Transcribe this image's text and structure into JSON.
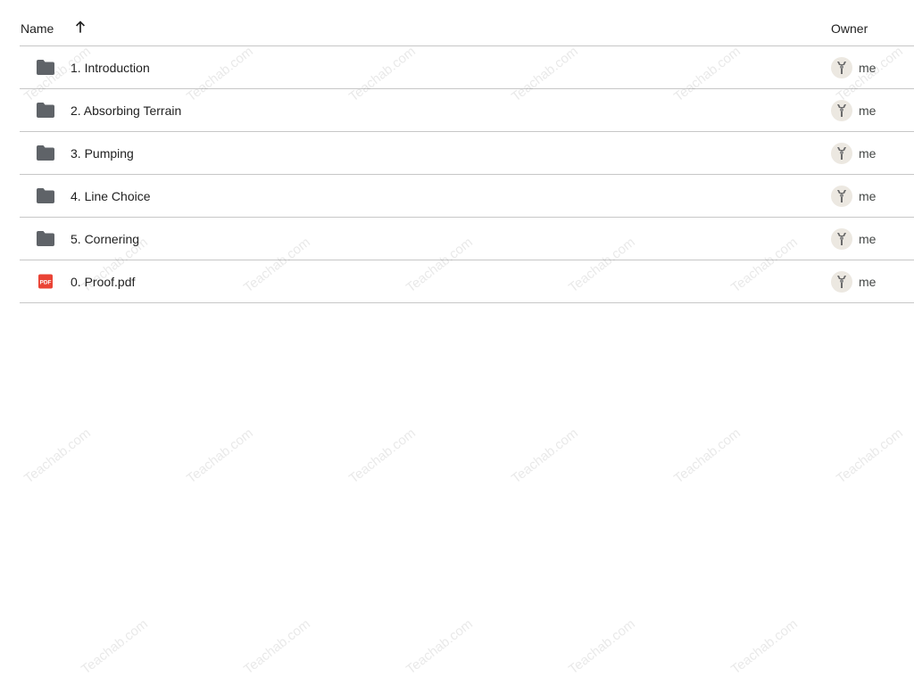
{
  "header": {
    "name_label": "Name",
    "owner_label": "Owner",
    "sort_icon": "arrow-upward-icon"
  },
  "items": [
    {
      "name": "1. Introduction",
      "type": "folder",
      "icon": "folder-icon",
      "owner": "me"
    },
    {
      "name": "2. Absorbing Terrain",
      "type": "folder",
      "icon": "folder-icon",
      "owner": "me"
    },
    {
      "name": "3. Pumping",
      "type": "folder",
      "icon": "folder-icon",
      "owner": "me"
    },
    {
      "name": "4. Line Choice",
      "type": "folder",
      "icon": "folder-icon",
      "owner": "me"
    },
    {
      "name": "5. Cornering",
      "type": "folder",
      "icon": "folder-icon",
      "owner": "me"
    },
    {
      "name": "0. Proof.pdf",
      "type": "pdf",
      "icon": "pdf-file-icon",
      "icon_text": "PDF",
      "owner": "me"
    }
  ],
  "watermark": "Teachab.com",
  "colors": {
    "folder": "#5f6368",
    "pdf": "#ea4335",
    "divider": "#c7c7c7",
    "avatar_bg": "#ece8e1"
  }
}
